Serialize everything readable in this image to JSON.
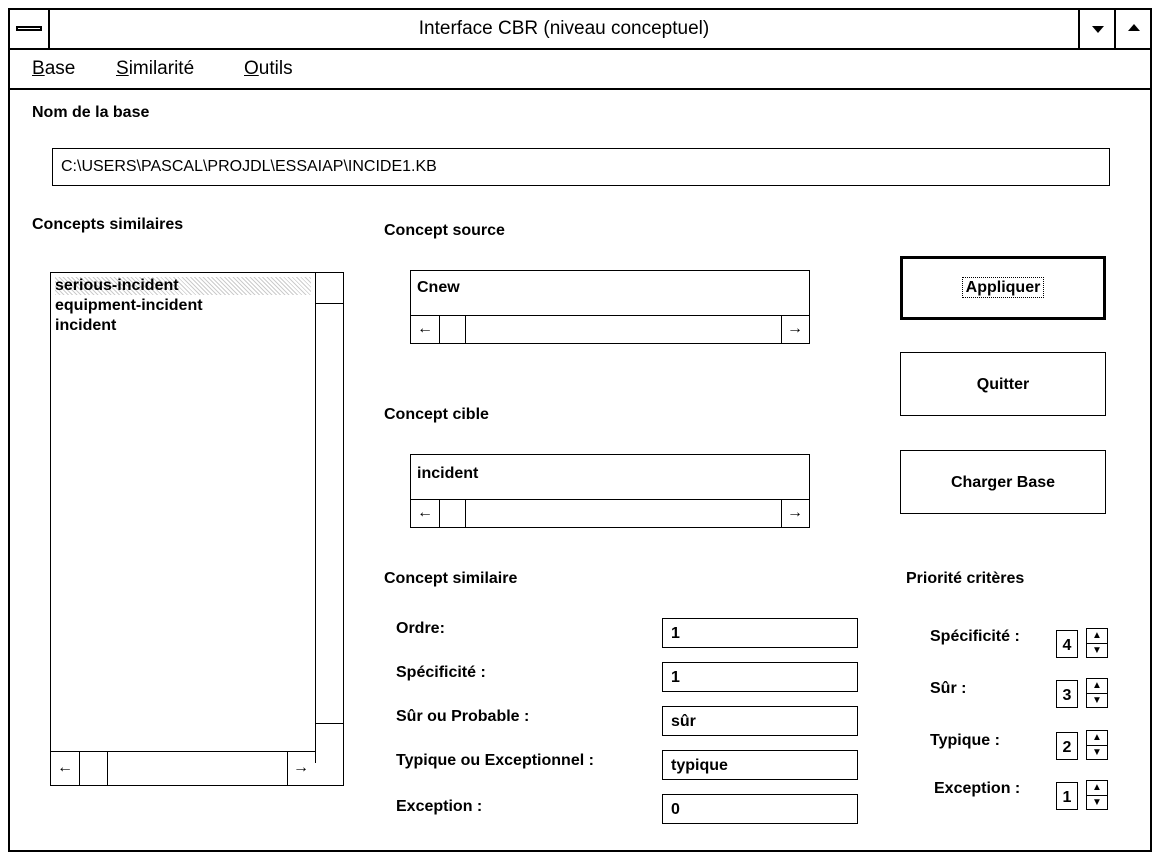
{
  "window": {
    "title": "Interface CBR (niveau conceptuel)"
  },
  "menu": [
    {
      "first": "B",
      "rest": "ase"
    },
    {
      "first": "S",
      "rest": "imilarité"
    },
    {
      "first": "O",
      "rest": "utils"
    }
  ],
  "base": {
    "label": "Nom de la base",
    "path": "C:\\USERS\\PASCAL\\PROJDL\\ESSAIAP\\INCIDE1.KB"
  },
  "similar_concepts": {
    "label": "Concepts similaires",
    "items": [
      "serious-incident",
      "equipment-incident",
      "incident"
    ],
    "selected_index": 0
  },
  "source": {
    "label": "Concept source",
    "value": "Cnew"
  },
  "target": {
    "label": "Concept cible",
    "value": "incident"
  },
  "similar": {
    "label": "Concept similaire",
    "fields": [
      {
        "label": "Ordre:",
        "value": "1"
      },
      {
        "label": "Spécificité :",
        "value": "1"
      },
      {
        "label": "Sûr ou Probable :",
        "value": "sûr"
      },
      {
        "label": "Typique ou Exceptionnel :",
        "value": "typique"
      },
      {
        "label": "Exception :",
        "value": "0"
      }
    ]
  },
  "buttons": {
    "apply": "Appliquer",
    "quit": "Quitter",
    "load": "Charger Base"
  },
  "priority": {
    "label": "Priorité critères",
    "items": [
      {
        "label": "Spécificité :",
        "value": "4"
      },
      {
        "label": "Sûr :",
        "value": "3"
      },
      {
        "label": "Typique :",
        "value": "2"
      },
      {
        "label": "Exception :",
        "value": "1"
      }
    ]
  },
  "glyphs": {
    "left": "←",
    "right": "→",
    "up": "▲",
    "down": "▼"
  }
}
